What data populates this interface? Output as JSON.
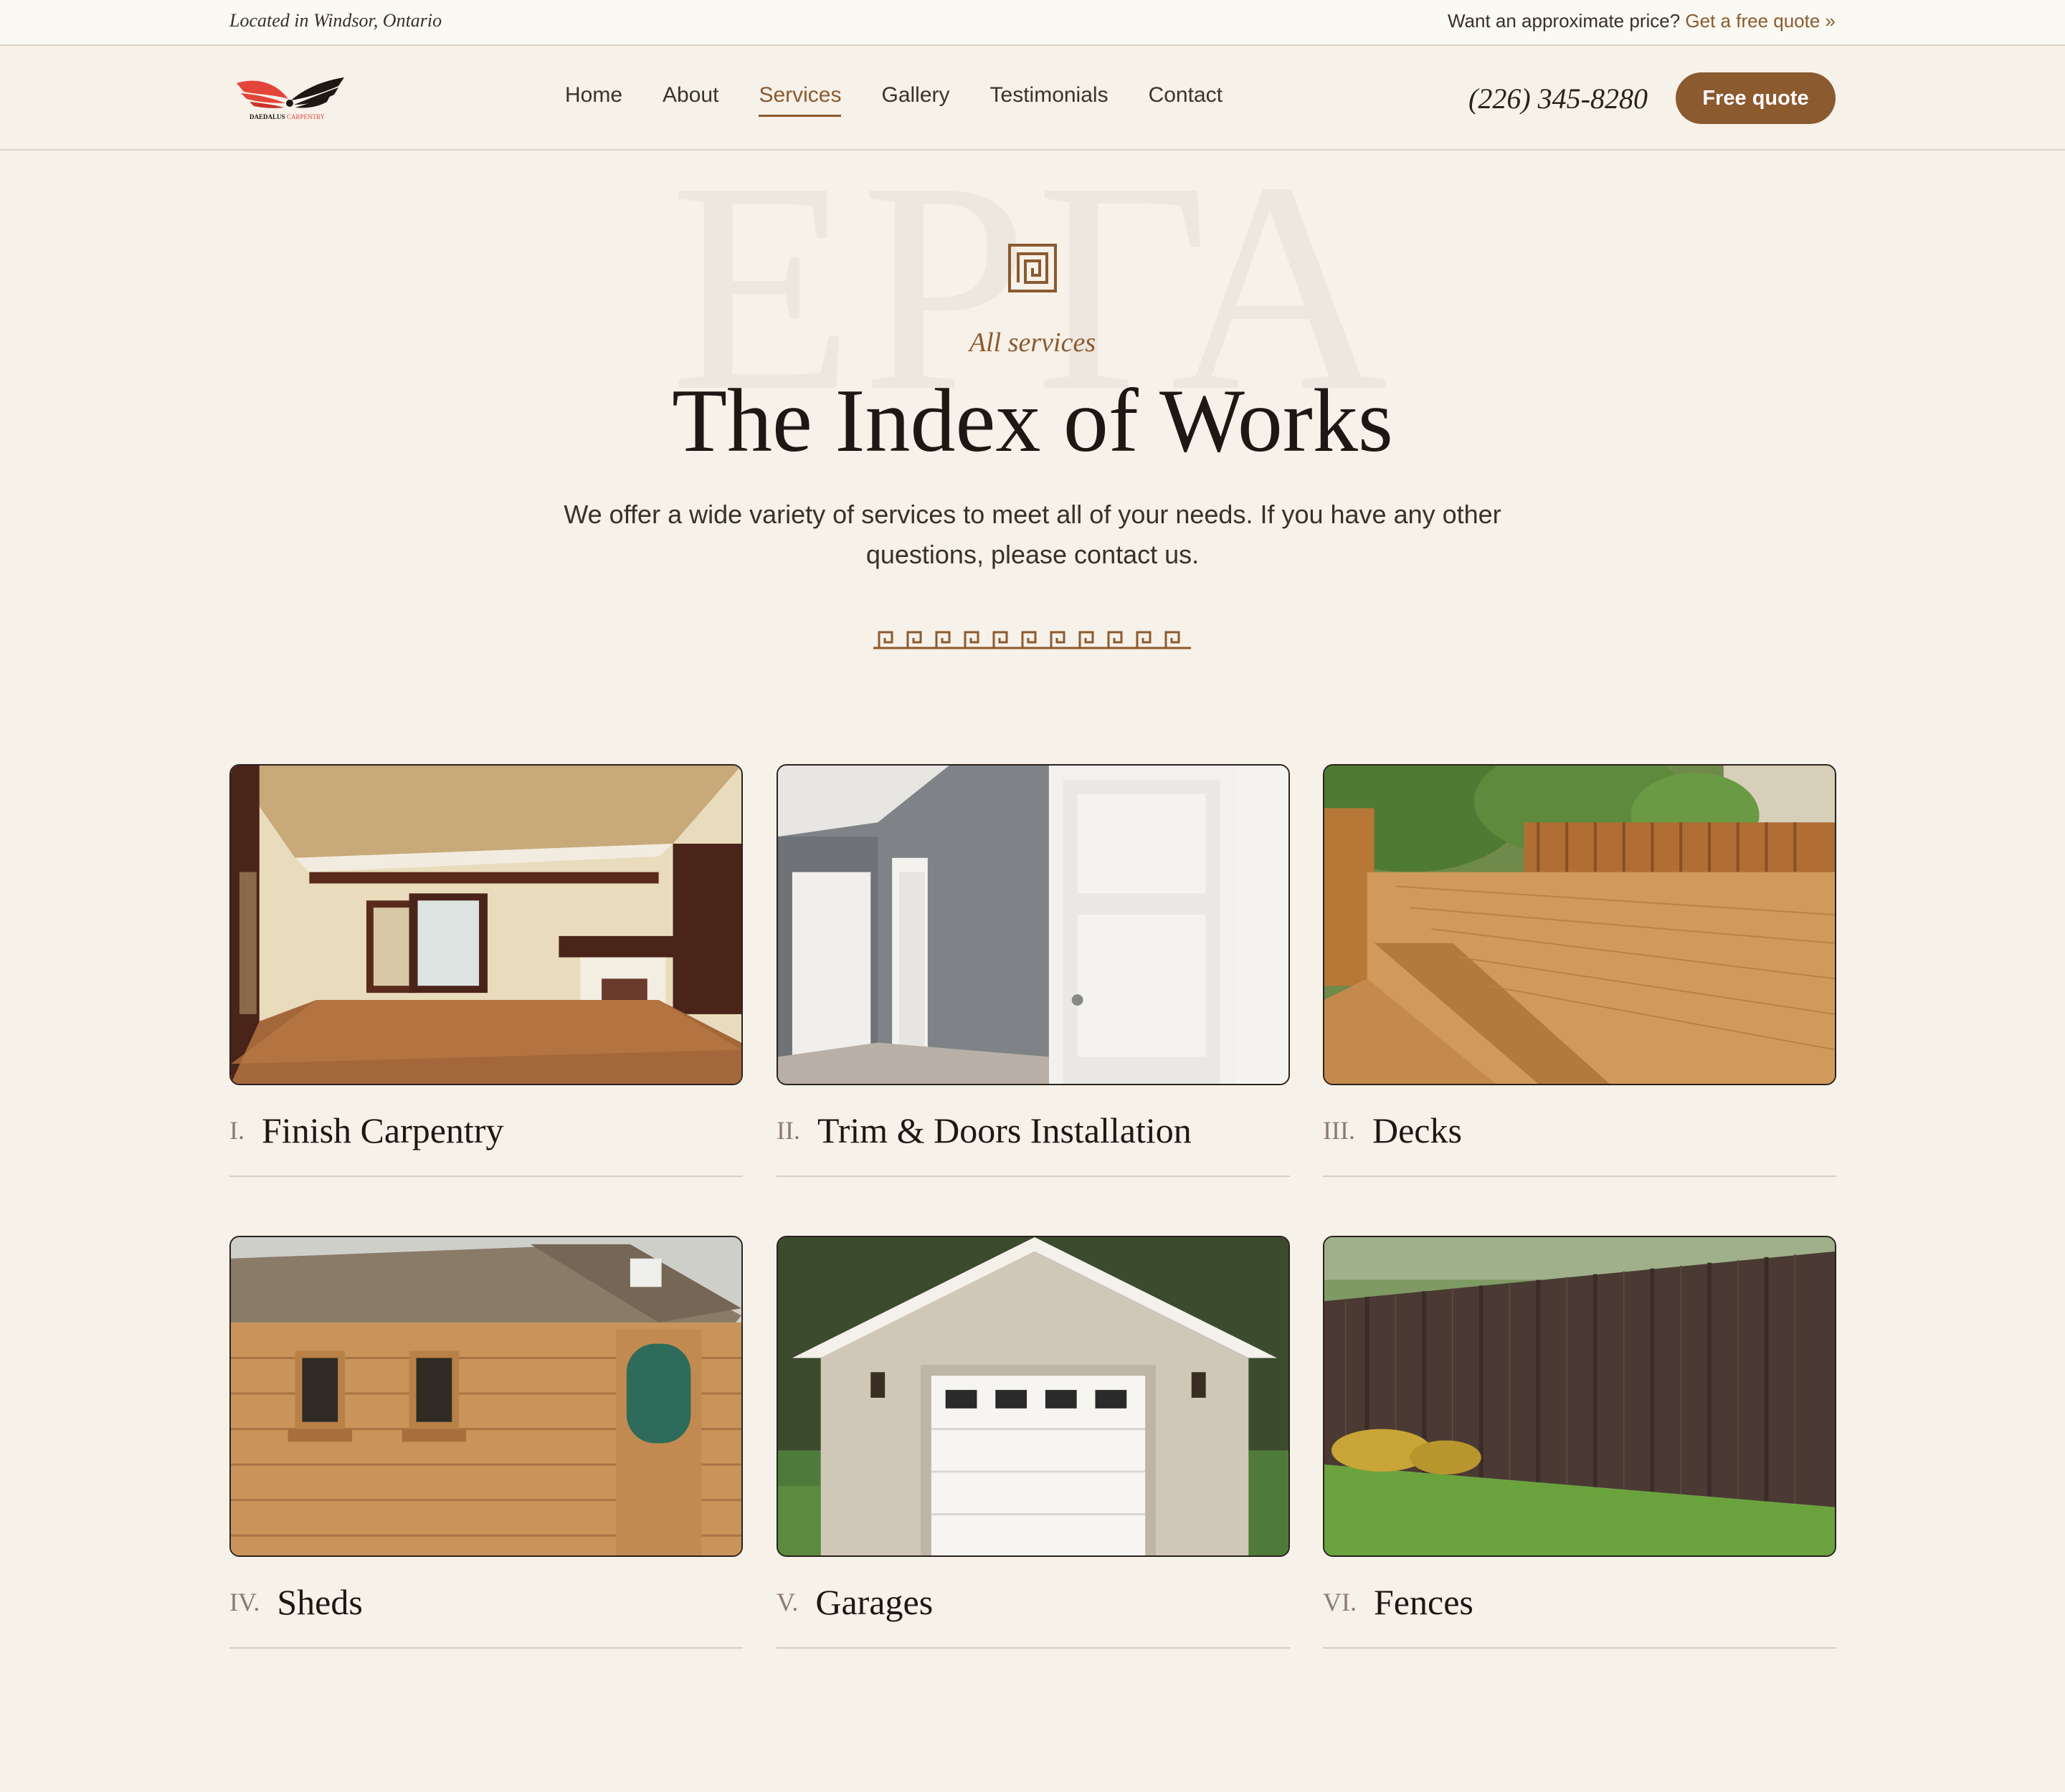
{
  "topbar": {
    "location": "Located in Windsor, Ontario",
    "quote_prompt": "Want an approximate price?",
    "quote_link": "Get a free quote »"
  },
  "brand": {
    "name": "DAEDALUS",
    "tagline": "CARPENTRY"
  },
  "nav": {
    "items": [
      {
        "label": "Home"
      },
      {
        "label": "About"
      },
      {
        "label": "Services",
        "active": true
      },
      {
        "label": "Gallery"
      },
      {
        "label": "Testimonials"
      },
      {
        "label": "Contact"
      }
    ]
  },
  "header": {
    "phone": "(226) 345-8280",
    "cta": "Free quote"
  },
  "hero": {
    "watermark": "ΕΡΓΑ",
    "eyebrow": "All services",
    "title": "The Index of Works",
    "lead": "We offer a wide variety of services to meet all of your needs. If you have any other questions, please contact us."
  },
  "services": [
    {
      "num": "I.",
      "name": "Finish Carpentry"
    },
    {
      "num": "II.",
      "name": "Trim & Doors Installation"
    },
    {
      "num": "III.",
      "name": "Decks"
    },
    {
      "num": "IV.",
      "name": "Sheds"
    },
    {
      "num": "V.",
      "name": "Garages"
    },
    {
      "num": "VI.",
      "name": "Fences"
    }
  ],
  "colors": {
    "accent": "#8b5a2f",
    "background": "#f6f1e9",
    "text": "#1e1814"
  }
}
